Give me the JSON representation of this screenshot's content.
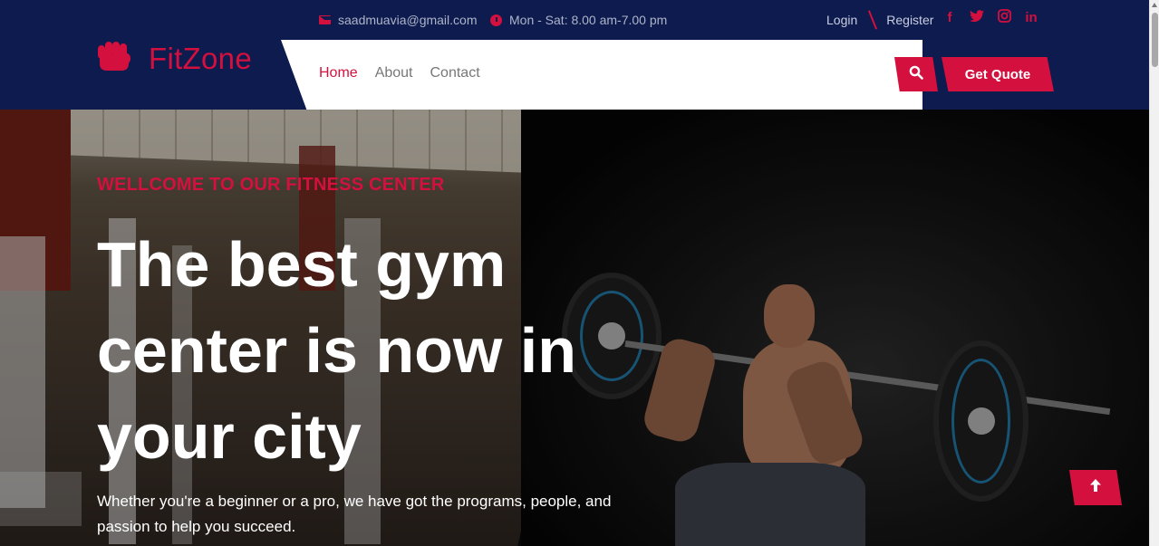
{
  "header": {
    "email": "saadmuavia@gmail.com",
    "hours": "Mon - Sat: 8.00 am-7.00 pm",
    "login_label": "Login",
    "register_label": "Register",
    "social": [
      "facebook-icon",
      "twitter-icon",
      "instagram-icon",
      "linkedin-icon"
    ],
    "social_glyphs": [
      "f",
      "t",
      "◎",
      "in"
    ]
  },
  "brand": {
    "name": "FitZone",
    "icon": "fist-icon"
  },
  "nav": {
    "items": [
      {
        "label": "Home",
        "active": true
      },
      {
        "label": "About",
        "active": false
      },
      {
        "label": "Contact",
        "active": false
      }
    ],
    "quote_label": "Get Quote"
  },
  "hero": {
    "eyebrow": "WELLCOME TO OUR FITNESS CENTER",
    "headline": "The best gym center is now in your city",
    "subtext": "Whether you're a beginner or a pro, we have got the programs, people, and passion to help you succeed."
  },
  "colors": {
    "brand_red": "#d4103e",
    "navy": "#0d1b4f"
  }
}
